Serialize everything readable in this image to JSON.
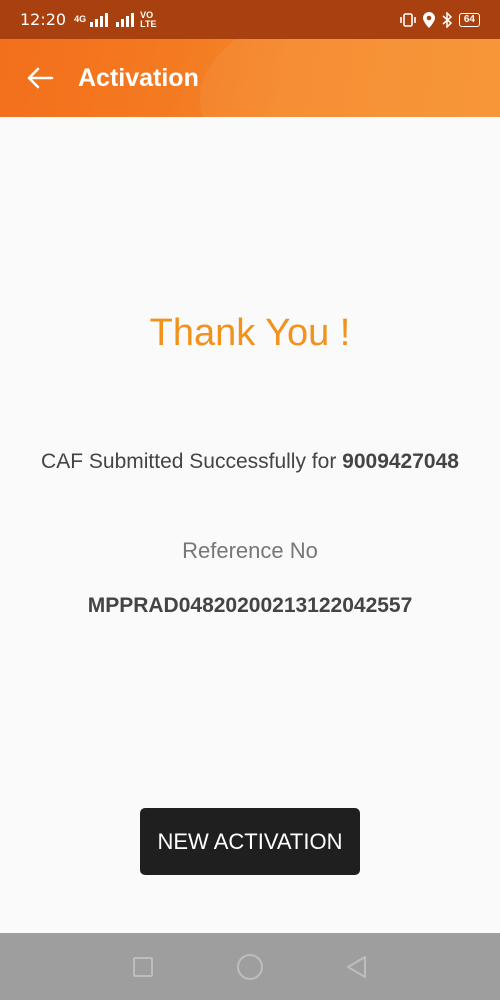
{
  "status_bar": {
    "time": "12:20",
    "network": "4G",
    "volte": "VO\nLTE",
    "battery": "64"
  },
  "app_bar": {
    "title": "Activation"
  },
  "content": {
    "thank_you": "Thank You !",
    "caf_prefix": "CAF Submitted Successfully for ",
    "mobile_number": "9009427048",
    "reference_label": "Reference No",
    "reference_number": "MPPRAD04820200213122042557"
  },
  "actions": {
    "new_activation_label": "NEW ACTIVATION"
  },
  "colors": {
    "status_bar": "#a8410f",
    "app_bar": "#f47a21",
    "accent_text": "#f0921c",
    "button_bg": "#1f1f1f",
    "nav_bar": "#9e9e9e"
  }
}
